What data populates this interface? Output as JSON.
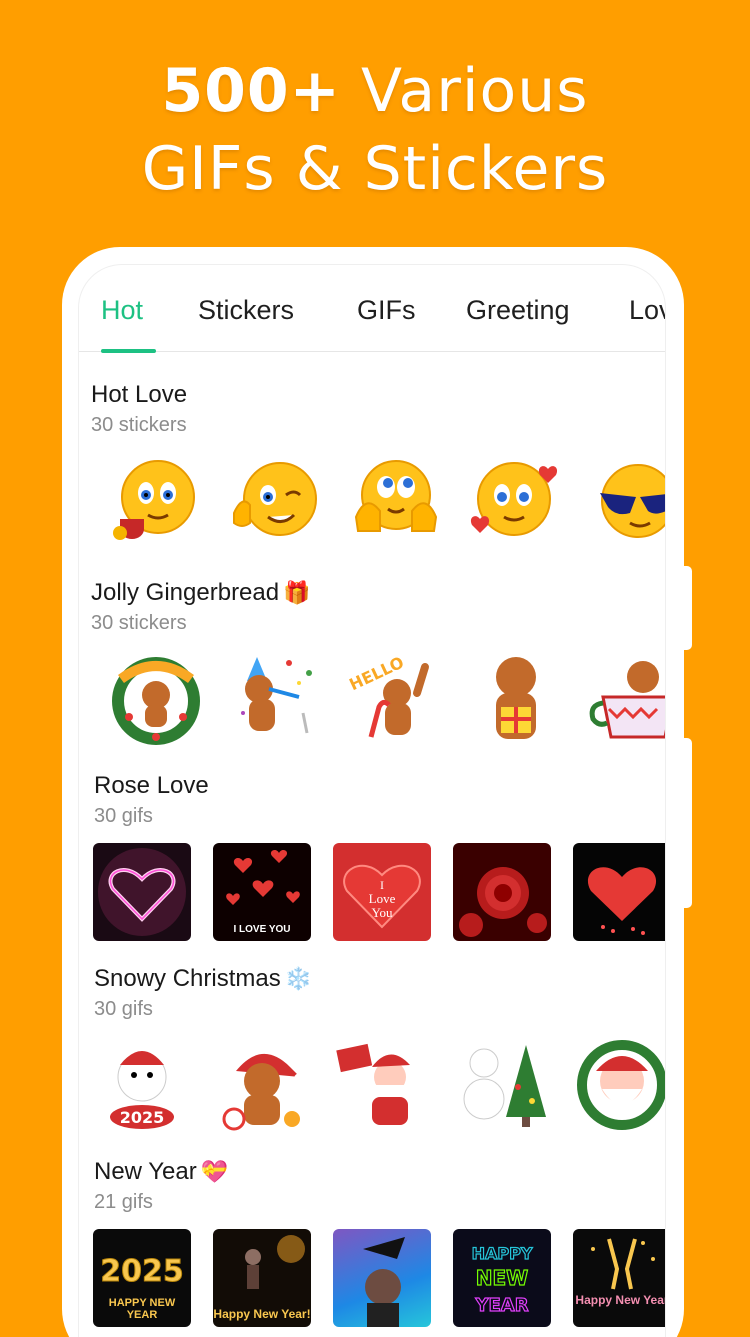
{
  "headline": {
    "line1_bold": "500+",
    "line1_rest": "Various",
    "line2": "GIFs & Stickers"
  },
  "tabs": [
    {
      "label": "Hot",
      "active": true
    },
    {
      "label": "Stickers",
      "active": false
    },
    {
      "label": "GIFs",
      "active": false
    },
    {
      "label": "Greeting",
      "active": false
    },
    {
      "label": "Love",
      "active": false
    }
  ],
  "colors": {
    "background": "#FF9E00",
    "accent": "#1DC183"
  },
  "sections": [
    {
      "title": "Hot Love",
      "emoji": "",
      "count": "30 stickers",
      "kind": "sticker",
      "items": [
        "emoji-tea-icon",
        "emoji-wink-icon",
        "emoji-dreamy-icon",
        "emoji-hearts-icon",
        "emoji-sunglasses-icon"
      ]
    },
    {
      "title": "Jolly Gingerbread",
      "emoji": "🎁",
      "count": "30 stickers",
      "kind": "sticker",
      "items": [
        "gingerbread-wreath-icon",
        "gingerbread-party-icon",
        "gingerbread-hello-icon",
        "gingerbread-gift-icon",
        "gingerbread-mug-icon"
      ]
    },
    {
      "title": "Rose Love",
      "emoji": "",
      "count": "30 gifs",
      "kind": "gif",
      "items": [
        "neon-heart-gif",
        "i-love-you-hearts-gif",
        "i-love-you-balloons-gif",
        "red-rose-gif",
        "glitter-heart-gif"
      ],
      "captions": [
        "",
        "I LOVE YOU",
        "",
        "",
        ""
      ]
    },
    {
      "title": "Snowy Christmas",
      "emoji": "❄️",
      "count": "30 gifs",
      "kind": "sticker",
      "items": [
        "snowman-2025-icon",
        "gingerbread-santa-hat-icon",
        "santa-sign-icon",
        "snowman-tree-icon",
        "santa-wreath-icon"
      ]
    },
    {
      "title": "New Year",
      "emoji": "💝",
      "count": "21 gifs",
      "kind": "gif",
      "items": [
        "happy-new-year-2025-gif",
        "happy-new-year-dance-gif",
        "party-hat-gif",
        "neon-new-year-gif",
        "champagne-new-year-gif"
      ],
      "captions": [
        "HAPPY NEW YEAR",
        "Happy New Year!",
        "",
        "",
        "Happy New Year"
      ]
    }
  ]
}
